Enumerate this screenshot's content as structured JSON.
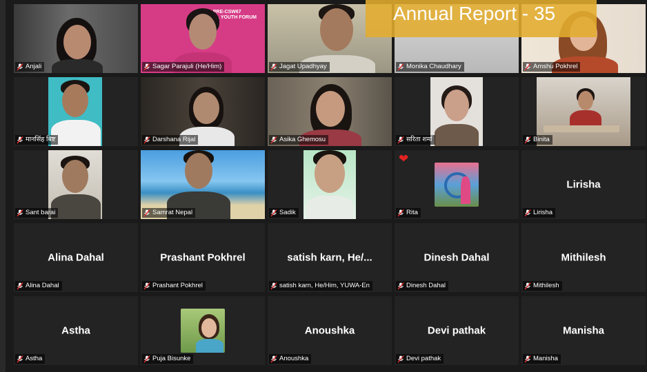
{
  "overlay_banner": "Annual Report - 35",
  "colors": {
    "background": "#1a1a1a",
    "tile_background": "#232323",
    "banner": "#e3ac2e",
    "muted_mic": "#e03030",
    "reaction_heart": "#e32222"
  },
  "tiles": [
    {
      "name": "Anjali",
      "center": "",
      "video": true,
      "muted": true
    },
    {
      "name": "Sagar Parajuli (He/Him)",
      "center": "",
      "video": true,
      "muted": true,
      "poster_text": [
        "PRE-CSW67",
        "AL YOUTH FORUM"
      ]
    },
    {
      "name": "Jagat Upadhyay",
      "center": "",
      "video": true,
      "muted": true
    },
    {
      "name": "Monika Chaudhary",
      "center": "",
      "video": true,
      "muted": true
    },
    {
      "name": "Amshu Pokhrel",
      "center": "",
      "video": true,
      "muted": true
    },
    {
      "name": "मानसिंह बिष्ट",
      "center": "",
      "video": true,
      "muted": true
    },
    {
      "name": "Darshana Rijal",
      "center": "",
      "video": true,
      "muted": true
    },
    {
      "name": "Asika Ghemosu",
      "center": "",
      "video": true,
      "muted": true
    },
    {
      "name": "सरिता शर्मा",
      "center": "",
      "video": true,
      "muted": true
    },
    {
      "name": "Binita",
      "center": "",
      "video": true,
      "muted": true
    },
    {
      "name": "Sant barai",
      "center": "",
      "video": true,
      "muted": true
    },
    {
      "name": "Samrat Nepal",
      "center": "",
      "video": true,
      "muted": true
    },
    {
      "name": "Sadik",
      "center": "",
      "video": true,
      "muted": true
    },
    {
      "name": "Rita",
      "center": "",
      "video": true,
      "muted": true,
      "reaction": "❤"
    },
    {
      "name": "Lirisha",
      "center": "Lirisha",
      "video": false,
      "muted": true
    },
    {
      "name": "Alina Dahal",
      "center": "Alina Dahal",
      "video": false,
      "muted": true
    },
    {
      "name": "Prashant Pokhrel",
      "center": "Prashant Pokhrel",
      "video": false,
      "muted": true
    },
    {
      "name": "satish karn, He/Him, YUWA-En",
      "center": "satish karn, He/...",
      "video": false,
      "muted": true
    },
    {
      "name": "Dinesh Dahal",
      "center": "Dinesh Dahal",
      "video": false,
      "muted": true
    },
    {
      "name": "Mithilesh",
      "center": "Mithilesh",
      "video": false,
      "muted": true
    },
    {
      "name": "Astha",
      "center": "Astha",
      "video": false,
      "muted": true
    },
    {
      "name": "Puja Bisunke",
      "center": "",
      "video": false,
      "muted": true,
      "profile_photo": true
    },
    {
      "name": "Anoushka",
      "center": "Anoushka",
      "video": false,
      "muted": true
    },
    {
      "name": "Devi pathak",
      "center": "Devi pathak",
      "video": false,
      "muted": true
    },
    {
      "name": "Manisha",
      "center": "Manisha",
      "video": false,
      "muted": true
    }
  ]
}
